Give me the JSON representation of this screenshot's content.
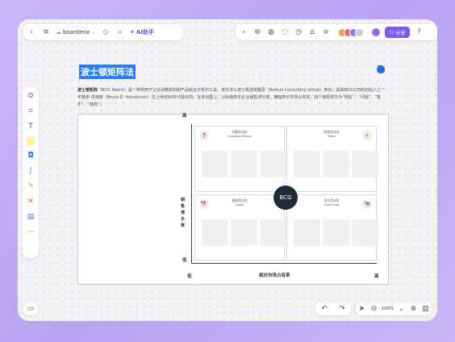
{
  "app": {
    "file_name": "boardmix",
    "ai_label": "AI助手",
    "share_label": "分享"
  },
  "document": {
    "title": "波士顿矩阵法",
    "description_lead": "波士顿矩阵",
    "description": "（BCG Matrix）是一种常用于企业战略规划和产品组合分析的工具。该方法以波士顿咨询集团（Boston Consulting Group）命名，是由BCG公司的创始人之一布鲁斯·亨德森（Bruce D. Henderson）在上世纪60年代提出的。在坐标图上，以纵轴表示企业销售增长率，横轴表示市场占有率，四个象限依次为“明星”、“问题”、“金牛”、“瘦狗”。"
  },
  "matrix": {
    "center_label": "BCG",
    "y_axis": {
      "high": "高",
      "low": "低",
      "label": "销售增长率"
    },
    "x_axis": {
      "low": "低",
      "high": "高",
      "label": "相对市场占有率"
    },
    "quadrants": [
      {
        "name_cn": "问题类业务",
        "name_en": "Question Marks",
        "icon": "question-mark-icon"
      },
      {
        "name_cn": "明星类业务",
        "name_en": "Stars",
        "icon": "star-icon"
      },
      {
        "name_cn": "瘦狗类业务",
        "name_en": "Dogs",
        "icon": "dog-icon"
      },
      {
        "name_cn": "金牛类业务",
        "name_en": "Cash Cow",
        "icon": "cow-icon"
      }
    ]
  },
  "zoom": {
    "level": "100%"
  },
  "colors": {
    "accent": "#7b5cf0",
    "title_highlight": "#2a7df0",
    "bcg_circle": "#1f2a38"
  }
}
